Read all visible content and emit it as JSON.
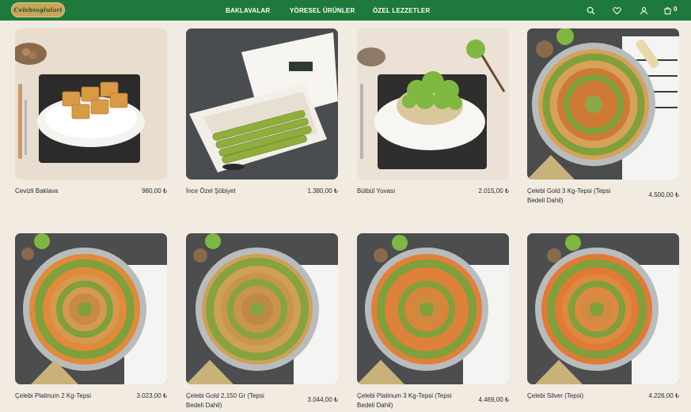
{
  "header": {
    "logo_text": "Celebioglulari",
    "nav": [
      "BAKLAVALAR",
      "YÖRESEL ÜRÜNLER",
      "ÖZEL LEZZETLER"
    ],
    "cart_count": "0"
  },
  "colors": {
    "brand_green": "#1e7a3c",
    "background": "#f1ebe2",
    "logo_gold": "#c9a55a"
  },
  "icons": [
    "search-icon",
    "heart-icon",
    "user-icon",
    "cart-icon"
  ],
  "products": [
    {
      "name": "Cevizli Baklava",
      "price": "980,00 ₺"
    },
    {
      "name": "İnce Özel Şöbiyet",
      "price": "1.380,00 ₺"
    },
    {
      "name": "Bülbül Yuvası",
      "price": "2.015,00 ₺"
    },
    {
      "name": "Çelebi Gold 3 Kg-Tepsi (Tepsi Bedeli Dahil)",
      "price": "4.500,00 ₺"
    },
    {
      "name": "Çelebi Platinum 2 Kg-Tepsi",
      "price": "3.023,00 ₺"
    },
    {
      "name": "Çelebi Gold 2,150 Gr (Tepsi Bedeli Dahil)",
      "price": "3.044,00 ₺"
    },
    {
      "name": "Çelebi Platinum 3 Kg-Tepsi (Tepsi Bedeli Dahil)",
      "price": "4.469,00 ₺"
    },
    {
      "name": "Çelebi Silver (Tepsi)",
      "price": "4.226,00 ₺"
    }
  ]
}
